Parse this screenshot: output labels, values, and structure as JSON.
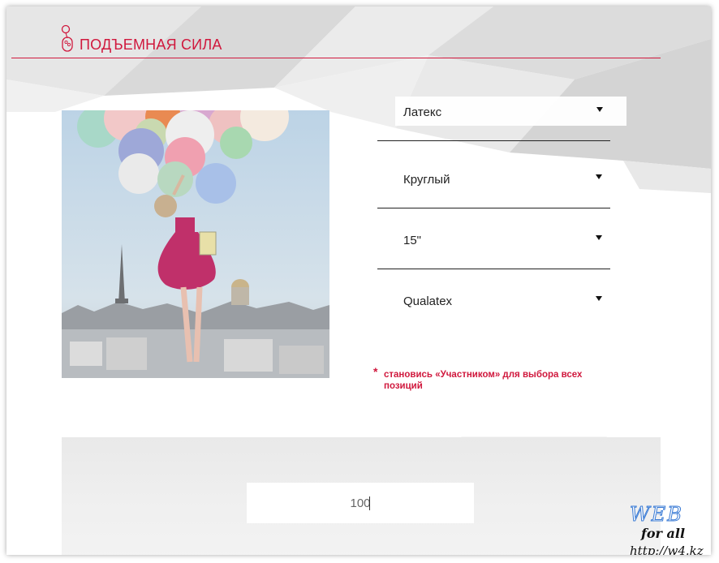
{
  "header": {
    "title": "ПОДЪЕМНАЯ СИЛА",
    "accent_color": "#d0183d",
    "logo_icon": "balloon-icon"
  },
  "main": {
    "photo": {
      "description_icon": "balloons-photo",
      "alt": ""
    },
    "selects": [
      {
        "value": "Латекс",
        "icon": "triangle-down-icon"
      },
      {
        "value": "Круглый",
        "icon": "triangle-down-icon"
      },
      {
        "value": "15\"",
        "icon": "triangle-down-icon"
      },
      {
        "value": "Qualatex",
        "icon": "triangle-down-icon"
      }
    ],
    "note": {
      "marker": "*",
      "text": "становись «Участником» для выбора всех позиций"
    }
  },
  "bottom": {
    "amount_value": "100"
  },
  "watermark": {
    "line1": "WEB",
    "line2": "for all",
    "line3": "http://w4.kz"
  }
}
